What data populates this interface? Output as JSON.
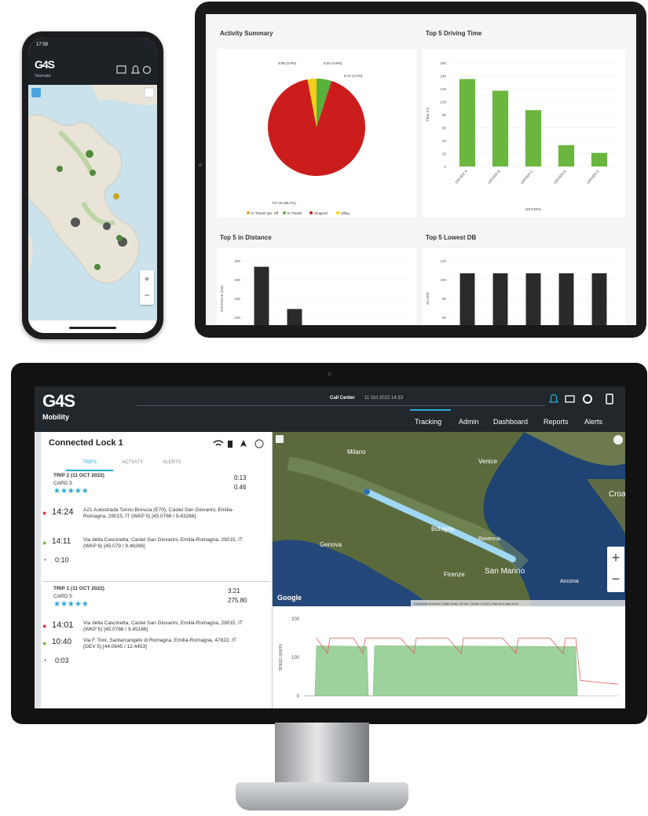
{
  "phone": {
    "status_time": "17:58",
    "logo": "G4S",
    "subtitle": "Telematic",
    "header_icons": [
      "map-icon",
      "bell-icon",
      "gear-icon"
    ],
    "zoom_in": "+",
    "zoom_out": "−"
  },
  "tablet": {
    "panels": {
      "activity_summary": {
        "title": "Activity Summary"
      },
      "driving_time": {
        "title": "Top 5 Driving Time"
      },
      "distance": {
        "title": "Top 5 in Distance"
      },
      "lowest_db": {
        "title": "Top 5 Lowest DB"
      }
    }
  },
  "chart_data": [
    {
      "type": "pie",
      "title": "Activity Summary",
      "slices": [
        {
          "label": "Stopped",
          "value": 92,
          "color": "#cc1d1d"
        },
        {
          "label": "In Transit",
          "value": 5,
          "color": "#58b13b"
        },
        {
          "label": "Idling",
          "value": 3,
          "color": "#f2cf1c"
        }
      ],
      "labels": [
        "3:59 (2.9%)",
        "5:34 (4.9%)",
        "5:14 (4.2%)",
        "727:46 (89.7%)"
      ],
      "legend": [
        "In Transit Ign. Off",
        "In Transit",
        "Stopped",
        "Idling"
      ]
    },
    {
      "type": "bar",
      "title": "Top 5 Driving Time",
      "ylabel": "TIME (H)",
      "xlabel": "DRIVERS",
      "ylim": [
        0,
        160
      ],
      "yticks": [
        "160",
        "140",
        "120",
        "100",
        "80",
        "60",
        "40",
        "20",
        "0"
      ],
      "categories": [
        "DRIVER A",
        "DRIVER B",
        "DRIVER C",
        "DRIVER D",
        "DRIVER E"
      ],
      "values": [
        135,
        117,
        87,
        33,
        21
      ],
      "color": "#6ab63f"
    },
    {
      "type": "bar",
      "title": "Top 5 in Distance",
      "ylabel": "DISTANCE (KM)",
      "ylim": [
        0,
        250
      ],
      "yticks": [
        "250",
        "200",
        "150",
        "100",
        "50"
      ],
      "categories": [
        "A",
        "B",
        "C",
        "D",
        "E"
      ],
      "values": [
        230,
        90,
        10,
        8,
        5
      ],
      "color": "#2a2a2a"
    },
    {
      "type": "bar",
      "title": "Top 5 Lowest DB",
      "ylabel": "SCORE",
      "ylim": [
        0,
        120
      ],
      "yticks": [
        "120",
        "100",
        "80",
        "60",
        "40"
      ],
      "categories": [
        "A",
        "B",
        "C",
        "D",
        "E"
      ],
      "values": [
        100,
        100,
        100,
        100,
        100
      ],
      "color": "#2a2a2a"
    },
    {
      "type": "area",
      "ylabel": "SPEED (KM/H)",
      "yticks": [
        "200",
        "100",
        "0"
      ],
      "ylim": [
        0,
        200
      ],
      "series_color": "#7cc47a",
      "limit_color": "#e05c5c"
    }
  ],
  "monitor": {
    "logo": "G4S",
    "logo_sub": "Mobility",
    "center_title": "Call Center",
    "center_date": "11 Oct 2022 14:33",
    "nav": [
      "Tracking",
      "Admin",
      "Dashboard",
      "Reports",
      "Alerts"
    ],
    "active_nav": "Tracking",
    "device_title": "Connected Lock 1",
    "tabs": [
      "TRIPS",
      "ACTIVITY",
      "ALERTS"
    ],
    "trips": [
      {
        "title": "TRIP 2 (11 OCT 2022)",
        "card": "CARD 5",
        "stars": "★★★★★",
        "duration": "0:13",
        "distance": "0.46",
        "start_time": "14:24",
        "start_addr": "A21 Autostrada Torino Brescia (E70), Castel San Giovanni, Emilia-Romagna, 29015, IT (WKP 5) [45.0766 / 9.43266]",
        "end_time": "14:11",
        "end_addr": "Via della Cascinetta, Castel San Giovanni, Emilia-Romagna, 29015, IT (WKP 6) [45.079 / 9.46266]",
        "elapsed": "0:10"
      },
      {
        "title": "TRIP 1 (11 OCT 2022)",
        "card": "CARD 5",
        "stars": "★★★★★",
        "duration": "3:21",
        "distance": "275.80",
        "start_time": "14:01",
        "start_addr": "Via della Cascinetta, Castel San Giovanni, Emilia-Romagna, 29015, IT (WKP 5) [45.0766 / 9.45186]",
        "end_time": "10:40",
        "end_addr": "Via F. Toni, Santarcangelo di Romagna, Emilia-Romagna, 47822, IT (DEV 5) [44.0645 / 12.4453]",
        "elapsed": "0:03"
      }
    ],
    "map_labels": {
      "milan": "Milano",
      "venice": "Venice",
      "genoa": "Genova",
      "bologna": "Bologna",
      "florence": "Firenze",
      "san_marino": "San Marino",
      "ravenna": "Ravenna",
      "ancona": "Ancona",
      "croatia": "Croa",
      "google": "Google",
      "attribution": "Keyboard shortcuts | Map Data | 50 km | Terms of Use | Report a map error"
    },
    "zoom_in": "+",
    "zoom_out": "−"
  }
}
